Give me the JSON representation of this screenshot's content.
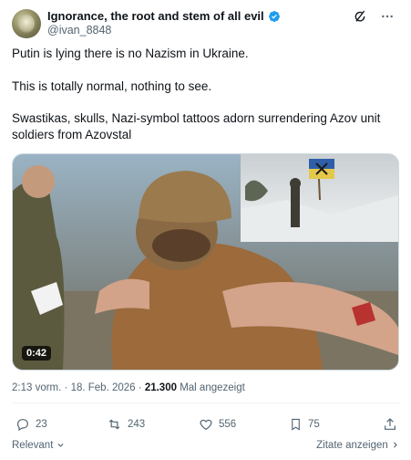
{
  "author": {
    "name": "Ignorance, the root and stem of all evil",
    "handle": "@ivan_8848"
  },
  "post": {
    "line1": "Putin is lying there is no Nazism in Ukraine.",
    "line2": "This is totally normal, nothing to see.",
    "line3a": "Swastikas, skulls, Nazi-symbol tattoos adorn surrendering Azov unit",
    "line3b": "soldiers from Azovstal"
  },
  "media": {
    "duration": "0:42"
  },
  "meta": {
    "time": "2:13 vorm.",
    "sep": "·",
    "date": "18. Feb. 2026",
    "sep2": "·",
    "views": "21.300",
    "views_label": "Mal angezeigt"
  },
  "actions": {
    "replies": "23",
    "reposts": "243",
    "likes": "556",
    "bookmarks": "75"
  },
  "footer": {
    "sort": "Relevant",
    "quotes": "Zitate anzeigen"
  },
  "colors": {
    "accent": "#1d9bf0",
    "muted": "#536471"
  },
  "icons": [
    "verified-badge-icon",
    "grok-icon",
    "more-icon",
    "reply-icon",
    "repost-icon",
    "like-icon",
    "bookmark-icon",
    "share-icon",
    "chevron-down-icon",
    "chevron-right-icon"
  ]
}
